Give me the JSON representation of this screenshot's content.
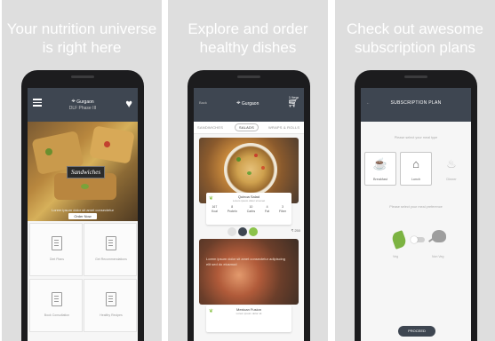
{
  "captions": {
    "panel1_line1": "Your nutrition universe",
    "panel1_line2": "is right here",
    "panel2_line1": "Explore and order",
    "panel2_line2": "healthy dishes",
    "panel3_line1": "Check out awesome",
    "panel3_line2": "subscription plans"
  },
  "screen1": {
    "location": "Gurgaon",
    "location_sub": "DLF Phase III",
    "brand": "Sandwiches",
    "hero_sub": "Lorem ipsum dolor sit amet consectetur",
    "hero_button": "Order Now",
    "tiles": [
      "Diet Plans",
      "Get Recommendations",
      "Book Consultation",
      "Healthy Recipes"
    ]
  },
  "screen2": {
    "back": "Back",
    "location": "Gurgaon",
    "cart_count": "1 Item",
    "tabs": [
      "SANDWICHES",
      "SALADS",
      "WRAPS & ROLLS"
    ],
    "dish1": {
      "name": "Quinoa Salad",
      "sub": "Lorem ipsum dolor sit amet",
      "nutrition": [
        {
          "value": "167",
          "unit": "Kcal"
        },
        {
          "value": "8",
          "unit": "Protein"
        },
        {
          "value": "10",
          "unit": "Carbs"
        },
        {
          "value": "4",
          "unit": "Fat"
        },
        {
          "value": "3",
          "unit": "Fiber"
        }
      ],
      "price": "₹ 250"
    },
    "dish2_text": "Lorem ipsum dolor sit amet consectetur adipiscing elit sed do eiusmod",
    "dish2": {
      "name": "Mexican Fusion",
      "sub": "Lorem ipsum dolor sit"
    }
  },
  "screen3": {
    "title": "SUBSCRIPTION PLAN",
    "meal_prompt": "Please select your meal type",
    "meals": [
      "Breakfast",
      "Lunch",
      "Dinner"
    ],
    "pref_prompt": "Please select your meal preference",
    "pref_veg": "Veg",
    "pref_nonveg": "Non Veg",
    "proceed": "PROCEED"
  },
  "colors": {
    "appbar": "#3e4651",
    "accent_green": "#8bc34a",
    "panel_bg": "#dedede"
  }
}
